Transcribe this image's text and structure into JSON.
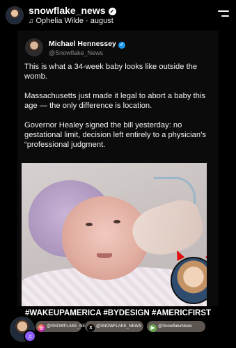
{
  "header": {
    "username": "snowflake_news",
    "audio_label": "Ophelia Wilde · august"
  },
  "tweet": {
    "author_name": "Michael Hennessey",
    "author_handle": "@Snowflake_News",
    "paragraphs": [
      "This is what a 34-week baby looks like outside the womb.",
      "Massachusetts just made it legal to abort a baby this age — the only difference is location.",
      "Governor Healey signed the bill yesterday: no gestational limit, decision left entirely to a physician’s “professional judgment."
    ]
  },
  "hashtags": "#WAKEUPAMERICA #BYDESIGN #AMERICFIRST",
  "footer": {
    "pills": [
      {
        "icon": "instagram-icon",
        "label": "@SNOWFLAKE_NEWS"
      },
      {
        "icon": "x-icon",
        "label": "@SNOWFLAKE_NEWS"
      },
      {
        "icon": "rumble-icon",
        "label": "@SnowflakeNews"
      }
    ]
  },
  "colors": {
    "background": "#000000",
    "verified_blue": "#1d9bf0",
    "pill_bg": "#5d5650",
    "music_badge": "#8b5cf6"
  }
}
